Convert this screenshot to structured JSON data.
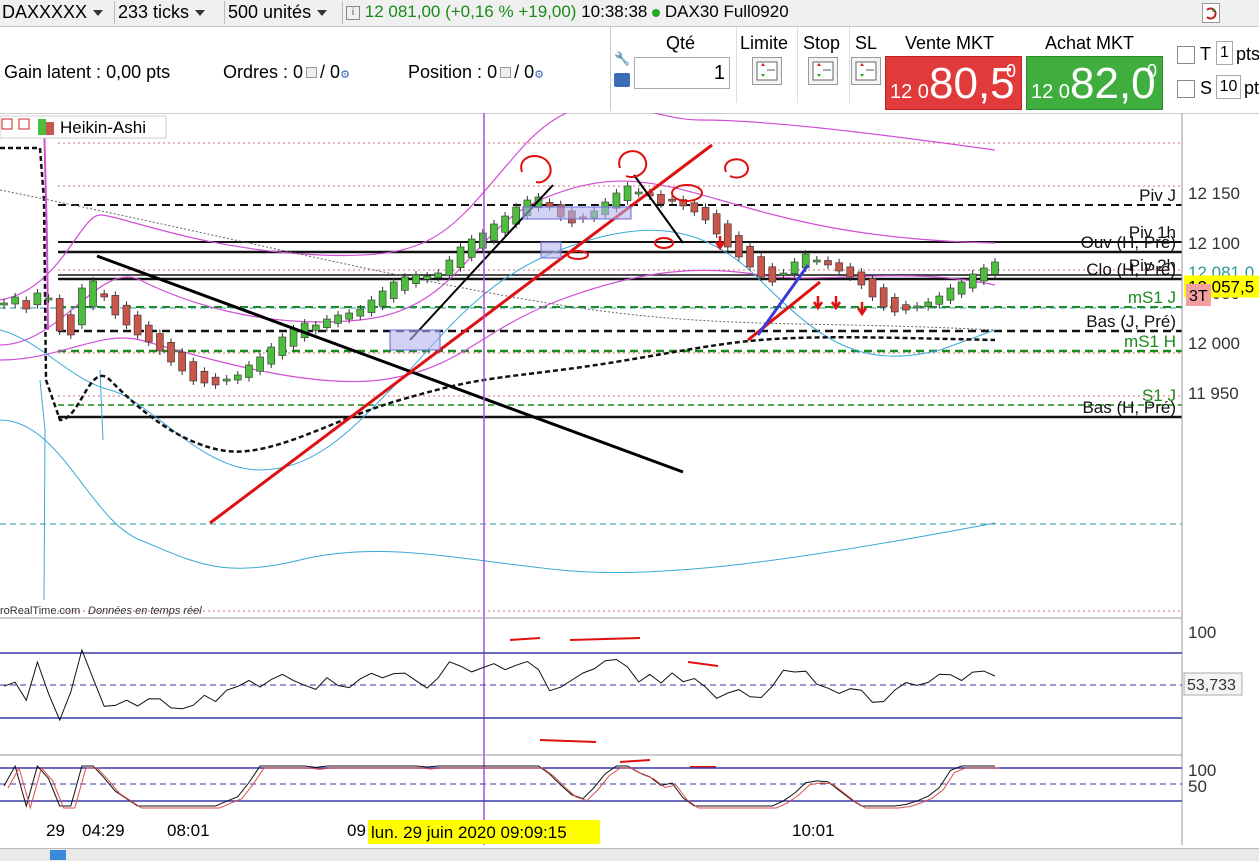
{
  "toolbar": {
    "instrument": "DAXXXXX",
    "ticks": "233 ticks",
    "units": "500 unités",
    "price": "12 081,00 (+0,16 % +19,00)",
    "time": "10:38:38",
    "product": "DAX30 Full0920"
  },
  "panel": {
    "gain_label": "Gain latent :",
    "gain_value": "0,00 pts",
    "orders_label": "Ordres :",
    "orders_a": "0",
    "orders_b": "/ 0",
    "position_label": "Position :",
    "position_a": "0",
    "position_b": "/ 0",
    "qty_label": "Qté",
    "qty_value": "1",
    "limit_label": "Limite",
    "stop_label": "Stop",
    "sl_label": "SL",
    "sell_label": "Vente MKT",
    "sell_small": "12 0",
    "sell_big": "80,5",
    "sell_sup": "0",
    "buy_label": "Achat MKT",
    "buy_small": "12 0",
    "buy_big": "82,0",
    "buy_sup": "0",
    "t_label": "T",
    "t_value": "1",
    "pts_label": "pts",
    "s_label": "S",
    "s_value": "10",
    "pt_label": "pt"
  },
  "chart": {
    "chart_type_label": "Heikin-Ashi",
    "source_text": "roRealTime.com",
    "source_sub": "Données en temps réel",
    "price_axis": [
      "12 150",
      "12 100",
      "12 050",
      "12 000",
      "11 950"
    ],
    "current_price_label": "12 081,0",
    "level_price_label": "12 057,5",
    "tag_3t": "3T",
    "levels": [
      "Piv J",
      "Piv 1h",
      "Ouv (H, Pré)",
      "Piv 2h",
      "Clo (H, Pré)",
      "mS1 J",
      "Bas (J, Pré)",
      "mS1 H",
      "S1 J",
      "Bas (H, Pré)"
    ],
    "rsi_axis": [
      "100"
    ],
    "rsi_value": "53,733",
    "stoch_axis": [
      "100",
      "50"
    ],
    "time_axis": [
      "29",
      "04:29",
      "08:01",
      "09",
      "10:01"
    ],
    "cursor_date": "lun. 29 juin 2020 09:09:15"
  },
  "colors": {
    "sell_bg": "#e03a3a",
    "buy_bg": "#3fae3f",
    "bull_candle": "#4cbd3c",
    "bear_candle": "#c9564b",
    "cursor_line": "#b04fd6",
    "pivot_green": "#1a8a1a"
  },
  "chart_data": {
    "type": "candlestick",
    "series_style": "Heikin-Ashi",
    "current_price": 12081.0,
    "marked_level": 12057.5,
    "y_ticks": [
      12150,
      12100,
      12050,
      12000,
      11950
    ],
    "levels": [
      {
        "label": "Piv J",
        "value": 12138
      },
      {
        "label": "Piv 1h",
        "value": 12101
      },
      {
        "label": "Ouv (H, Pré)",
        "value": 12091
      },
      {
        "label": "Piv 2h",
        "value": 12068
      },
      {
        "label": "Clo (H, Pré)",
        "value": 12064
      },
      {
        "label": "mS1 J",
        "value": 12036
      },
      {
        "label": "Bas (J, Pré)",
        "value": 12012
      },
      {
        "label": "mS1 H",
        "value": 11992
      },
      {
        "label": "S1 J",
        "value": 11938
      },
      {
        "label": "Bas (H, Pré)",
        "value": 11926
      }
    ],
    "closes": [
      12040,
      12046,
      12034,
      12050,
      12045,
      12012,
      12008,
      12055,
      12062,
      12046,
      12028,
      12018,
      12008,
      12001,
      11992,
      11981,
      11972,
      11962,
      11960,
      11958,
      11964,
      11968,
      11978,
      11986,
      11996,
      12006,
      12014,
      12020,
      12018,
      12024,
      12028,
      12030,
      12034,
      12043,
      12052,
      12061,
      12066,
      12068,
      12067,
      12070,
      12083,
      12096,
      12104,
      12110,
      12119,
      12127,
      12136,
      12143,
      12146,
      12136,
      12126,
      12120,
      12124,
      12132,
      12141,
      12150,
      12157,
      12151,
      12147,
      12139,
      12143,
      12137,
      12131,
      12123,
      12109,
      12096,
      12086,
      12076,
      12066,
      12061,
      12070,
      12081,
      12089,
      12083,
      12078,
      12072,
      12066,
      12058,
      12046,
      12036,
      12031,
      12033,
      12037,
      12041,
      12047,
      12055,
      12061,
      12069,
      12075,
      12081
    ],
    "rsi_value": 53.733
  }
}
